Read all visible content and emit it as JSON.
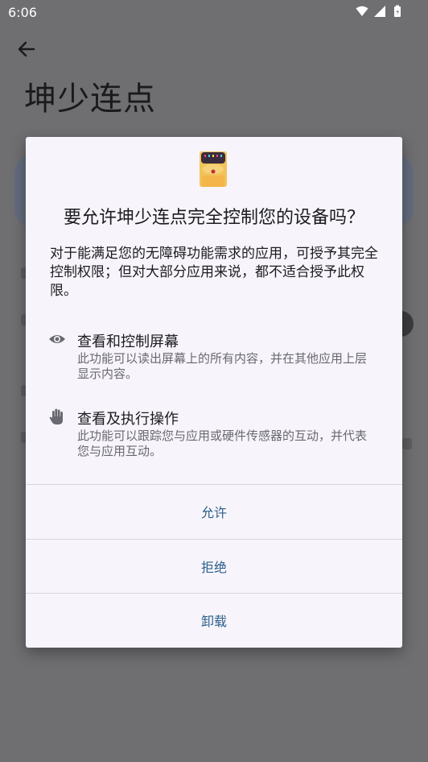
{
  "status_bar": {
    "time": "6:06"
  },
  "app": {
    "title": "坤少连点"
  },
  "dialog": {
    "title": "要允许坤少连点完全控制您的设备吗？",
    "description": "对于能满足您的无障碍功能需求的应用，可授予其完全控制权限；但对大部分应用来说，都不适合授予此权限。",
    "permissions": [
      {
        "icon": "eye-icon",
        "title": "查看和控制屏幕",
        "description": "此功能可以读出屏幕上的所有内容，并在其他应用上层显示内容。"
      },
      {
        "icon": "hand-icon",
        "title": "查看及执行操作",
        "description": "此功能可以跟踪您与应用或硬件传感器的互动，并代表您与应用互动。"
      }
    ],
    "actions": {
      "allow": "允许",
      "deny": "拒绝",
      "uninstall": "卸载"
    }
  },
  "colors": {
    "accent": "#2d5f8a",
    "dialog_bg": "#f7f5fb",
    "scrim": "#6f6f72"
  }
}
